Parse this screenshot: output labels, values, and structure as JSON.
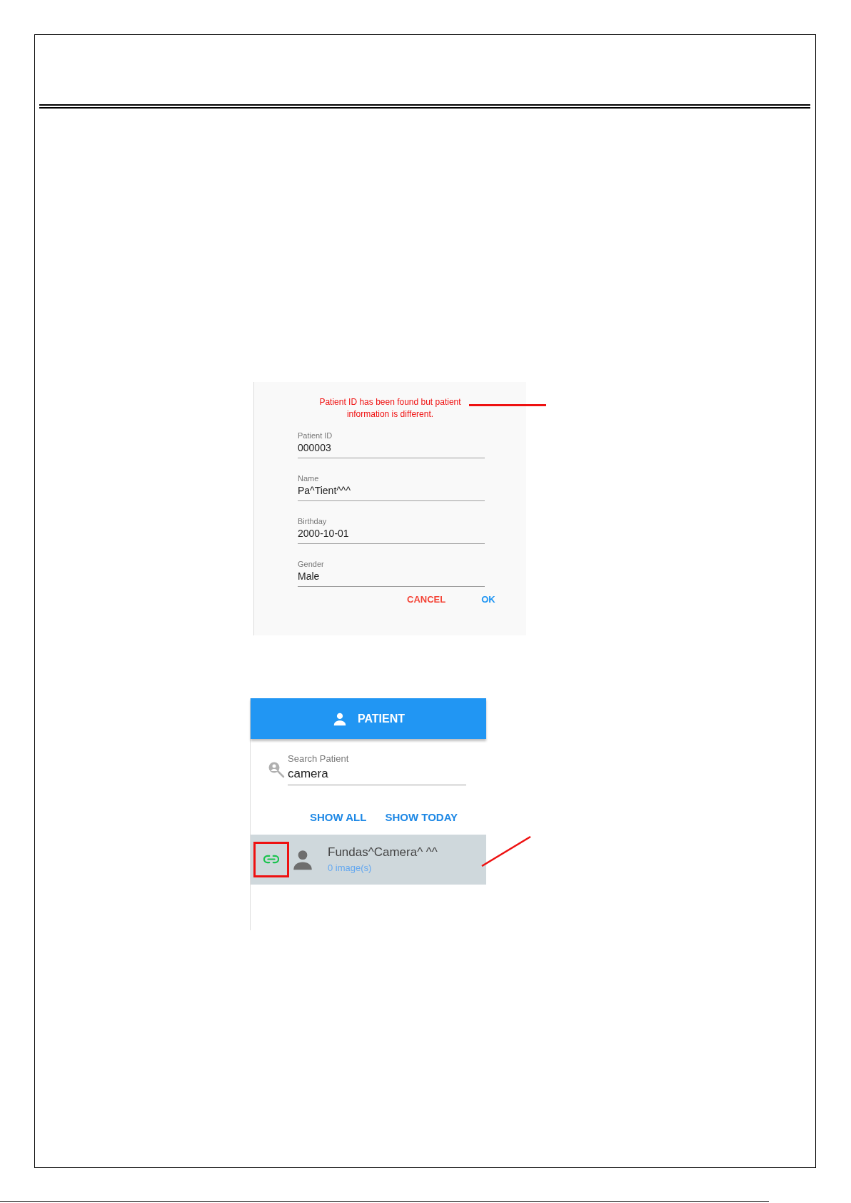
{
  "dialog": {
    "message": "Patient ID has been found but patient information is different.",
    "fields": [
      {
        "label": "Patient ID",
        "value": "000003"
      },
      {
        "label": "Name",
        "value": "Pa^Tient^^^"
      },
      {
        "label": "Birthday",
        "value": "2000-10-01"
      },
      {
        "label": "Gender",
        "value": "Male"
      }
    ],
    "buttons": [
      {
        "label": "CANCEL",
        "kind": "cancel"
      },
      {
        "label": "OK",
        "kind": "ok"
      }
    ]
  },
  "patient_panel": {
    "title": "PATIENT",
    "search": {
      "label": "Search Patient",
      "value": "camera"
    },
    "buttons": [
      "SHOW ALL",
      "SHOW TODAY"
    ],
    "results": [
      {
        "name": "Fundas^Camera^ ^^",
        "images": "0 image(s)",
        "linked": true,
        "selected": true
      }
    ]
  }
}
